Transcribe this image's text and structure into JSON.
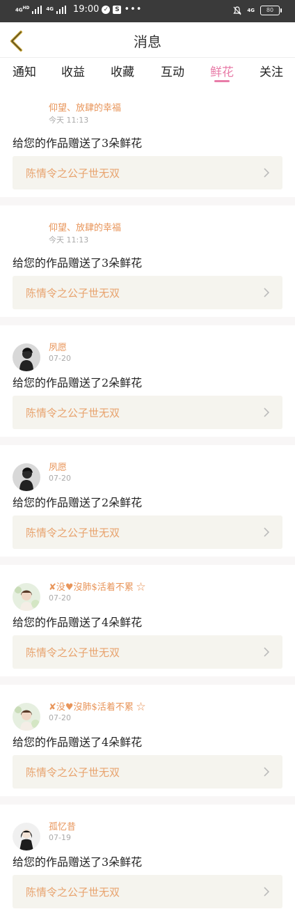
{
  "status_bar": {
    "network1": "4G",
    "network1_sup": "HD",
    "network2": "4G",
    "time": "19:00",
    "dots": "•••",
    "right_network": "4G",
    "battery": "80",
    "icons": [
      "signal-icon",
      "signal-icon",
      "check-circle-icon",
      "s-app-icon",
      "mute-bell-icon",
      "battery-icon"
    ]
  },
  "header": {
    "title": "消息",
    "back_icon": "chevron-left-icon"
  },
  "tabs": [
    {
      "label": "通知"
    },
    {
      "label": "收益"
    },
    {
      "label": "收藏"
    },
    {
      "label": "互动"
    },
    {
      "label": "鲜花",
      "active": true
    },
    {
      "label": "关注"
    }
  ],
  "messages": [
    {
      "name": "仰望、放肆的幸福",
      "time": "今天 11:13",
      "text": "给您的作品赠送了3朵鲜花",
      "work": "陈情令之公子世无双",
      "avatar": "none"
    },
    {
      "name": "仰望、放肆的幸福",
      "time": "今天 11:13",
      "text": "给您的作品赠送了3朵鲜花",
      "work": "陈情令之公子世无双",
      "avatar": "none"
    },
    {
      "name": "夙愿",
      "time": "07-20",
      "text": "给您的作品赠送了2朵鲜花",
      "work": "陈情令之公子世无双",
      "avatar": "dark"
    },
    {
      "name": "夙愿",
      "time": "07-20",
      "text": "给您的作品赠送了2朵鲜花",
      "work": "陈情令之公子世无双",
      "avatar": "dark"
    },
    {
      "name": "✘没♥沒肺$活着不累 ☆",
      "time": "07-20",
      "text": "给您的作品赠送了4朵鲜花",
      "work": "陈情令之公子世无双",
      "avatar": "girl"
    },
    {
      "name": "✘没♥沒肺$活着不累 ☆",
      "time": "07-20",
      "text": "给您的作品赠送了4朵鲜花",
      "work": "陈情令之公子世无双",
      "avatar": "girl"
    },
    {
      "name": "孤忆昔",
      "time": "07-19",
      "text": "给您的作品赠送了3朵鲜花",
      "work": "陈情令之公子世无双",
      "avatar": "anime"
    }
  ],
  "colors": {
    "accent": "#e87ca8",
    "username": "#e8955a",
    "work_title": "#e8a36e",
    "work_bg": "#f5f4ee"
  }
}
